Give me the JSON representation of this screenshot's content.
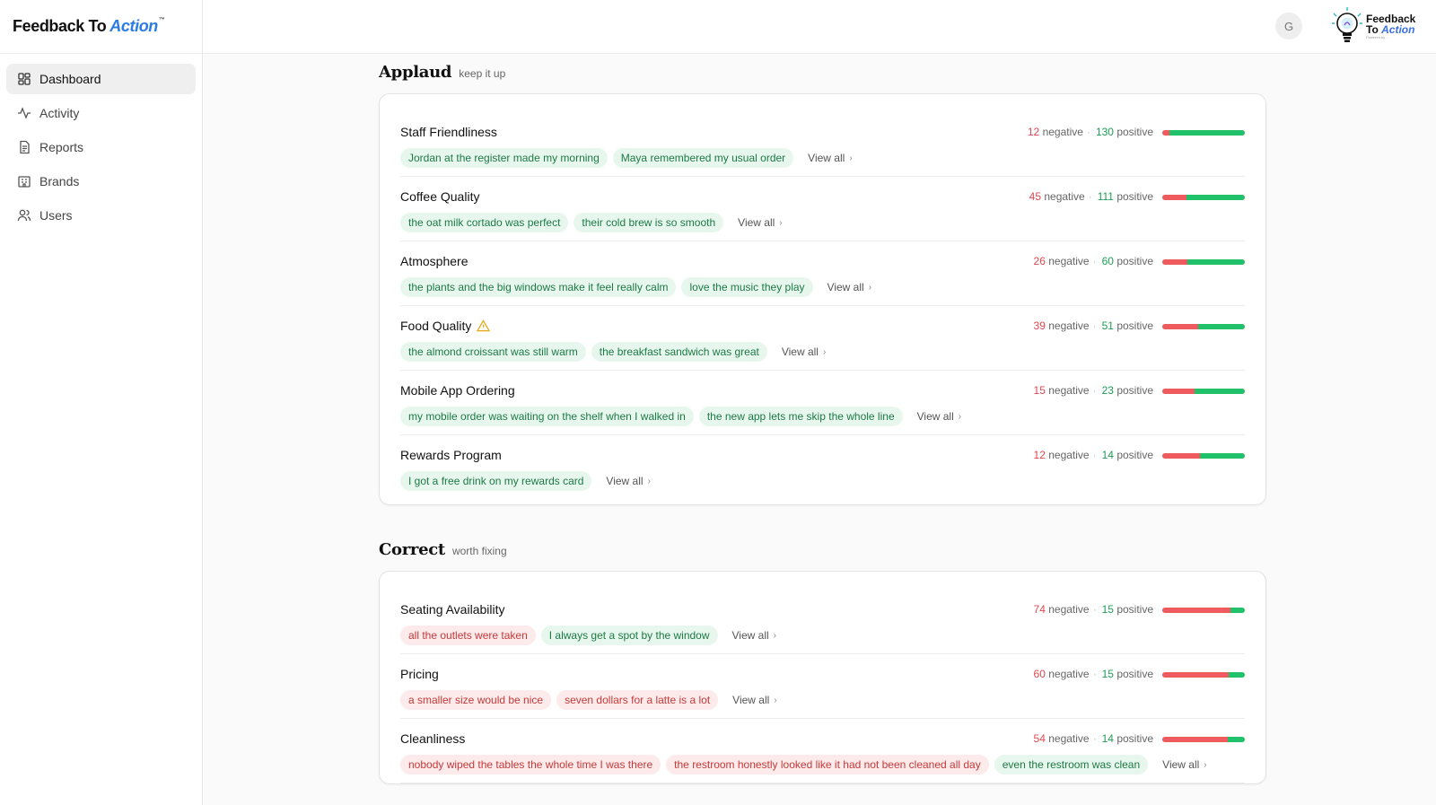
{
  "brand": {
    "name": "Feedback To",
    "accent": "Action",
    "tm": "™"
  },
  "logo_right": {
    "line1": "Feedback",
    "line2a": "To",
    "line2b": "Action",
    "sub": "Powered by ...",
    "badge_icon": "lightbulb-icon"
  },
  "avatar_initial": "G",
  "nav": [
    {
      "label": "Dashboard",
      "icon": "dashboard-icon",
      "active": true
    },
    {
      "label": "Activity",
      "icon": "activity-icon",
      "active": false
    },
    {
      "label": "Reports",
      "icon": "reports-icon",
      "active": false
    },
    {
      "label": "Brands",
      "icon": "brands-icon",
      "active": false
    },
    {
      "label": "Users",
      "icon": "users-icon",
      "active": false
    }
  ],
  "colors": {
    "negative": "#e0484f",
    "positive": "#1f9d55",
    "bar_negative": "#ef5a5f",
    "bar_positive": "#21c16b"
  },
  "labels": {
    "negative": "negative",
    "positive": "positive",
    "view_all": "View all"
  },
  "sections": [
    {
      "title": "Applaud",
      "subtitle": "keep it up",
      "rows": [
        {
          "title": "Staff Friendliness",
          "negative": "12",
          "positive": "130",
          "warning": false,
          "chips": [
            {
              "text": "Jordan at the register made my morning",
              "tone": "pos"
            },
            {
              "text": "Maya remembered my usual order",
              "tone": "pos"
            }
          ]
        },
        {
          "title": "Coffee Quality",
          "negative": "45",
          "positive": "111",
          "warning": false,
          "chips": [
            {
              "text": "the oat milk cortado was perfect",
              "tone": "pos"
            },
            {
              "text": "their cold brew is so smooth",
              "tone": "pos"
            }
          ]
        },
        {
          "title": "Atmosphere",
          "negative": "26",
          "positive": "60",
          "warning": false,
          "chips": [
            {
              "text": "the plants and the big windows make it feel really calm",
              "tone": "pos"
            },
            {
              "text": "love the music they play",
              "tone": "pos"
            }
          ]
        },
        {
          "title": "Food Quality",
          "negative": "39",
          "positive": "51",
          "warning": true,
          "chips": [
            {
              "text": "the almond croissant was still warm",
              "tone": "pos"
            },
            {
              "text": "the breakfast sandwich was great",
              "tone": "pos"
            }
          ]
        },
        {
          "title": "Mobile App Ordering",
          "negative": "15",
          "positive": "23",
          "warning": false,
          "chips": [
            {
              "text": "my mobile order was waiting on the shelf when I walked in",
              "tone": "pos"
            },
            {
              "text": "the new app lets me skip the whole line",
              "tone": "pos"
            }
          ]
        },
        {
          "title": "Rewards Program",
          "negative": "12",
          "positive": "14",
          "warning": false,
          "chips": [
            {
              "text": "I got a free drink on my rewards card",
              "tone": "pos"
            }
          ]
        }
      ]
    },
    {
      "title": "Correct",
      "subtitle": "worth fixing",
      "rows": [
        {
          "title": "Seating Availability",
          "negative": "74",
          "positive": "15",
          "warning": false,
          "chips": [
            {
              "text": "all the outlets were taken",
              "tone": "neg"
            },
            {
              "text": "I always get a spot by the window",
              "tone": "pos"
            }
          ]
        },
        {
          "title": "Pricing",
          "negative": "60",
          "positive": "15",
          "warning": false,
          "chips": [
            {
              "text": "a smaller size would be nice",
              "tone": "neg"
            },
            {
              "text": "seven dollars for a latte is a lot",
              "tone": "neg"
            }
          ]
        },
        {
          "title": "Cleanliness",
          "negative": "54",
          "positive": "14",
          "warning": false,
          "chips": [
            {
              "text": "nobody wiped the tables the whole time I was there",
              "tone": "neg"
            },
            {
              "text": "the restroom honestly looked like it had not been cleaned all day",
              "tone": "neg"
            },
            {
              "text": "even the restroom was clean",
              "tone": "pos"
            }
          ]
        }
      ]
    }
  ]
}
